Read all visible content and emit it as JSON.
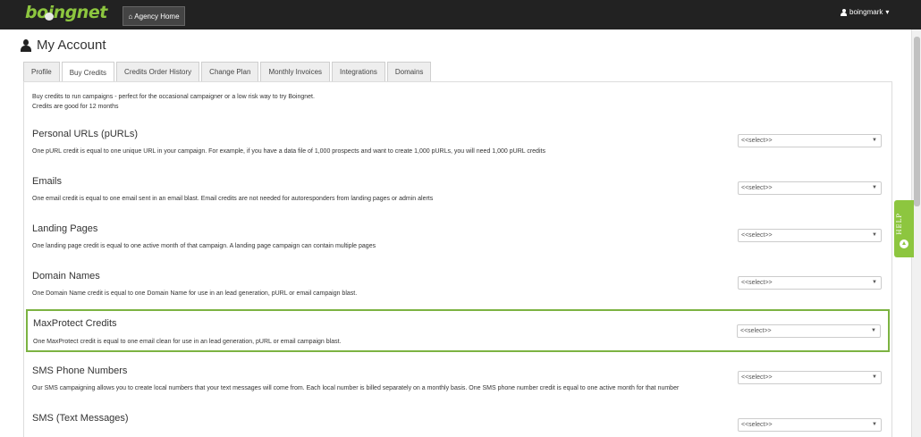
{
  "header": {
    "logo_text": "boingnet",
    "agency_home_label": "Agency Home",
    "user_name": "boingmark",
    "user_caret": "▾"
  },
  "page_title": "My Account",
  "tabs": [
    {
      "label": "Profile",
      "active": false
    },
    {
      "label": "Buy Credits",
      "active": true
    },
    {
      "label": "Credits Order History",
      "active": false
    },
    {
      "label": "Change Plan",
      "active": false
    },
    {
      "label": "Monthly Invoices",
      "active": false
    },
    {
      "label": "Integrations",
      "active": false
    },
    {
      "label": "Domains",
      "active": false
    }
  ],
  "intro": {
    "line1": "Buy credits to run campaigns - perfect for the occasional campaigner or a low risk way to try Boingnet.",
    "line2": "Credits are good for 12 months"
  },
  "sections": [
    {
      "title": "Personal URLs (pURLs)",
      "desc": "One pURL credit is equal to one unique URL in your campaign. For example, if you have a data file of 1,000 prospects and want to create 1,000 pURLs, you will need 1,000 pURL credits",
      "select": "<<select>>"
    },
    {
      "title": "Emails",
      "desc": "One email credit is equal to one email sent in an email blast. Email credits are not needed for autoresponders from landing pages or admin alerts",
      "select": "<<select>>"
    },
    {
      "title": "Landing Pages",
      "desc": "One landing page credit is equal to one active month of that campaign. A landing page campaign can contain multiple pages",
      "select": "<<select>>"
    },
    {
      "title": "Domain Names",
      "desc": "One Domain Name credit is equal to one Domain Name for use in an lead generation, pURL or email campaign blast.",
      "select": "<<select>>"
    },
    {
      "title": "MaxProtect Credits",
      "desc": "One MaxProtect credit is equal to one email clean for use in an lead generation, pURL or email campaign blast.",
      "select": "<<select>>",
      "highlighted": true
    },
    {
      "title": "SMS Phone Numbers",
      "desc": "Our SMS campaigning allows you to create local numbers that your text messages will come from. Each local number is billed separately on a monthly basis. One SMS phone number credit is equal to one active month for that number",
      "select": "<<select>>"
    },
    {
      "title": "SMS (Text Messages)",
      "desc": "",
      "select": "<<select>>"
    }
  ],
  "help_label": "HELP",
  "colors": {
    "accent": "#8dc63f",
    "highlight_border": "#7cb342",
    "topbar": "#222222"
  }
}
